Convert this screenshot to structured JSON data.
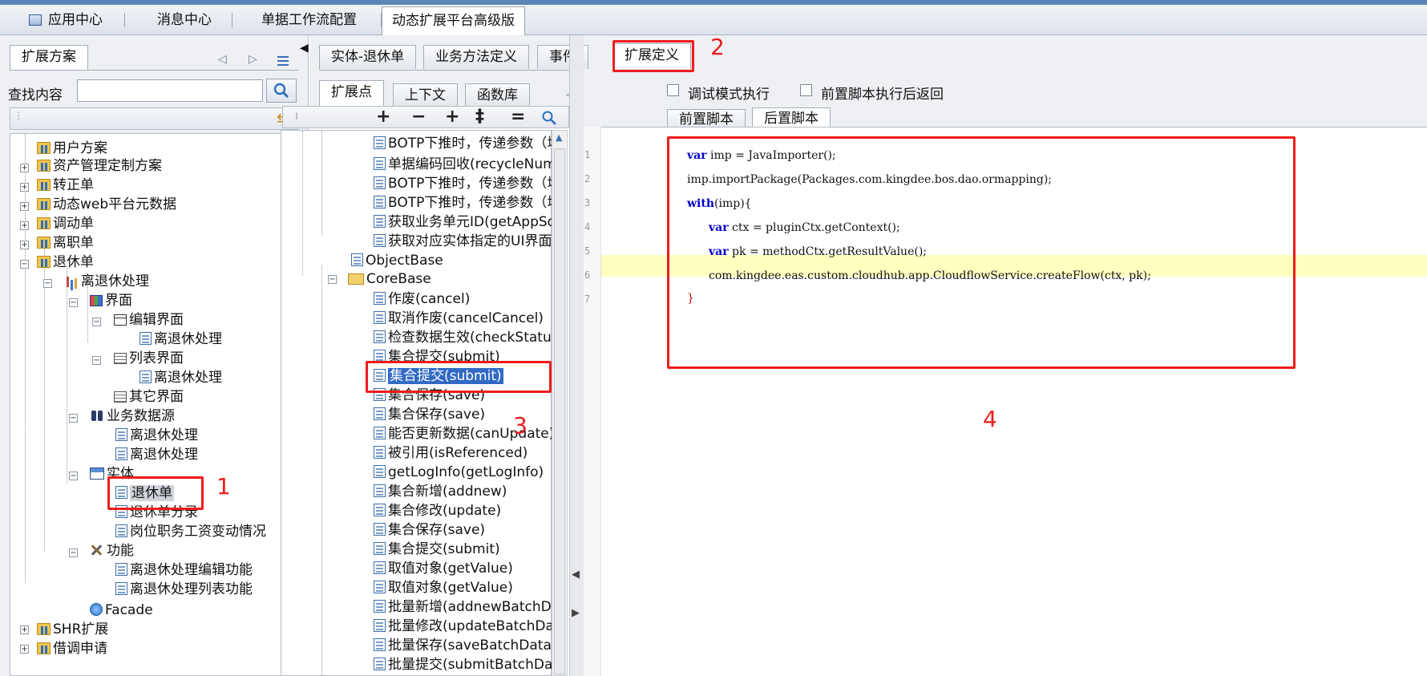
{
  "main_tabs": [
    "应用中心",
    "消息中心",
    "单据工作流配置",
    "动态扩展平台高级版"
  ],
  "left_panel": {
    "tab": "扩展方案",
    "search_label": "查找内容",
    "search_value": "",
    "tree": {
      "user_scheme": "用户方案",
      "asset_custom": "资产管理定制方案",
      "regular": "转正单",
      "dynweb": "动态web平台元数据",
      "transfer": "调动单",
      "resign": "离职单",
      "retire": "退休单",
      "retire_process": "离退休处理",
      "ui": "界面",
      "edit_ui": "编辑界面",
      "edit_ui_item": "离退休处理",
      "list_ui": "列表界面",
      "list_ui_item": "离退休处理",
      "other_ui": "其它界面",
      "biz_source": "业务数据源",
      "biz_item1": "离退休处理",
      "biz_item2": "离退休处理",
      "entity": "实体",
      "entity_retire": "退休单",
      "entity_entry": "退休单分录",
      "entity_salary": "岗位职务工资变动情况",
      "function": "功能",
      "func_edit": "离退休处理编辑功能",
      "func_list": "离退休处理列表功能",
      "facade": "Facade",
      "shr_ext": "SHR扩展",
      "borrow": "借调申请"
    }
  },
  "mid_tabs": [
    "实体-退休单",
    "业务方法定义",
    "事件",
    "扩展定义"
  ],
  "sub_tabs": [
    "扩展点",
    "上下文",
    "函数库"
  ],
  "ext_tree": {
    "items_top": [
      "BOTP下推时，传递参数（增加规则",
      "单据编码回收(recycleNumber)",
      "BOTP下推时，传递参数（增加规则",
      "BOTP下推时，传递参数（增加规则",
      "获取业务单元ID(getAppSolutionID)",
      "获取对应实体指定的UI界面的Uipk(g"
    ],
    "object_base": "ObjectBase",
    "core_base": "CoreBase",
    "core_items": [
      "作废(cancel)",
      "取消作废(cancelCancel)",
      "检查数据生效(checkStatusValid)",
      "集合提交(submit)",
      "集合提交(submit)",
      "集合保存(save)",
      "集合保存(save)",
      "能否更新数据(canUpdate)",
      "被引用(isReferenced)",
      "getLogInfo(getLogInfo)",
      "集合新增(addnew)",
      "集合修改(update)",
      "集合保存(save)",
      "集合提交(submit)",
      "取值对象(getValue)",
      "取值对象(getValue)",
      "批量新增(addnewBatchData)",
      "批量修改(updateBatchData)",
      "批量保存(saveBatchData)",
      "批量提交(submitBatchData)"
    ]
  },
  "right_panel": {
    "debug_label": "调试模式执行",
    "return_label": "前置脚本执行后返回",
    "script_tabs": [
      "前置脚本",
      "后置脚本"
    ],
    "line_numbers": [
      "1",
      "2",
      "3",
      "4",
      "5",
      "6",
      "7"
    ],
    "code": {
      "l1_kw": "var",
      "l1_rest": " imp = JavaImporter();",
      "l2": "imp.importPackage(Packages.com.kingdee.bos.dao.ormapping);",
      "l3_kw": "with",
      "l3_rest": "(imp){",
      "l4_kw": "var",
      "l4_rest": " ctx = pluginCtx.getContext();",
      "l5_kw": "var",
      "l5_rest": " pk = methodCtx.getResultValue();",
      "l6": "com.kingdee.eas.custom.cloudhub.app.CloudflowService.createFlow(ctx, pk);",
      "l7": "}"
    }
  },
  "annotations": [
    "1",
    "2",
    "3",
    "4"
  ],
  "colors": {
    "annotation": "#ee1c1c",
    "selection": "#316ac5",
    "keyword": "#0000c8"
  }
}
